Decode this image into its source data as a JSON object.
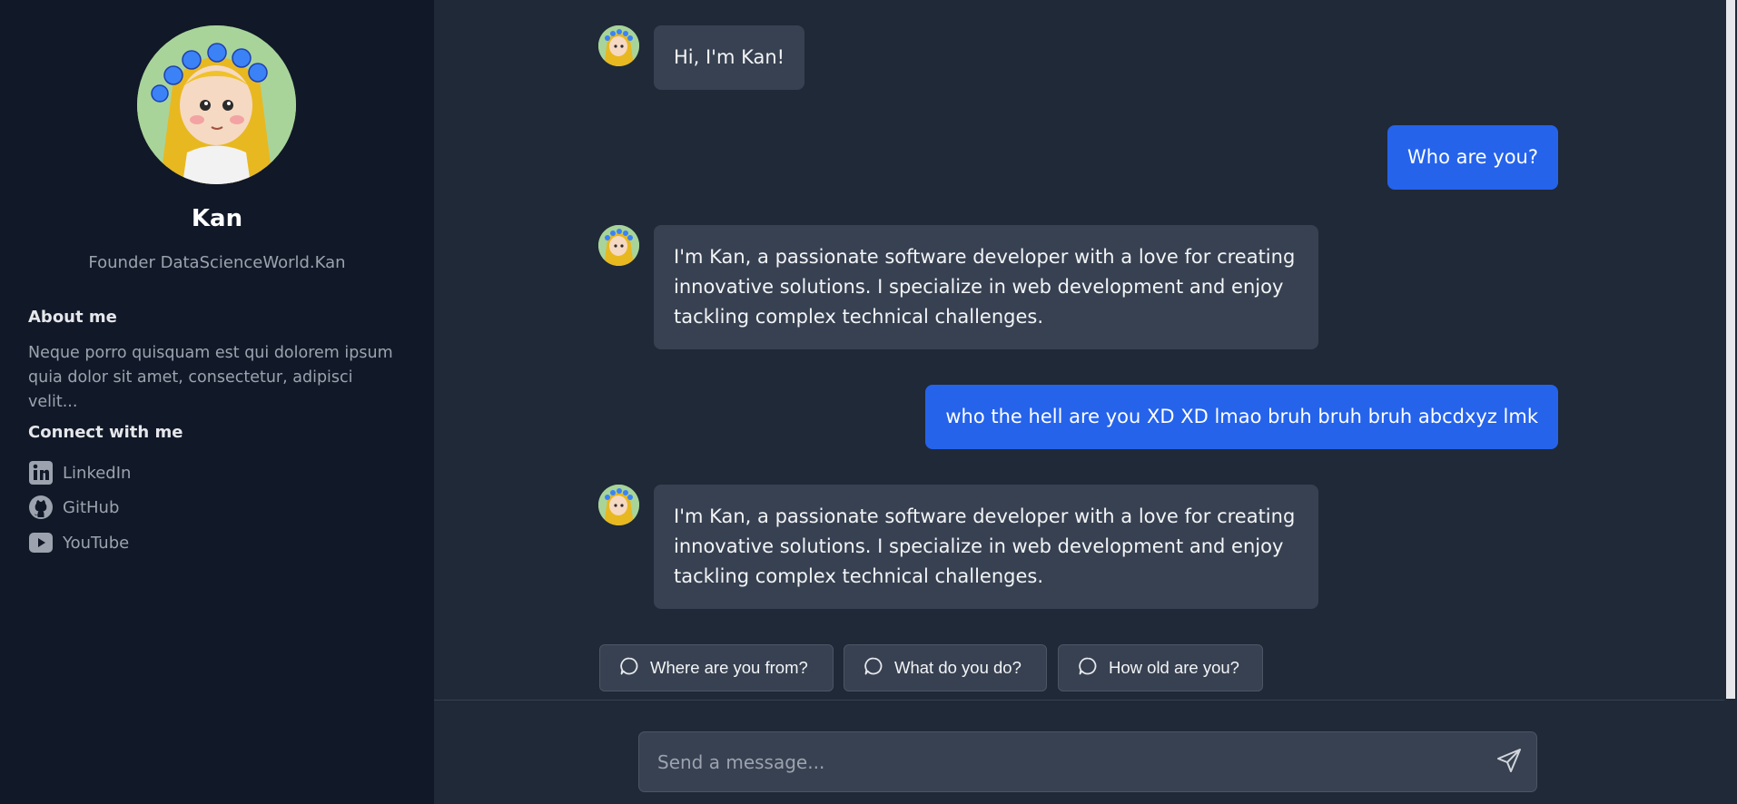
{
  "sidebar": {
    "name": "Kan",
    "title": "Founder DataScienceWorld.Kan",
    "about_heading": "About me",
    "about_text": "Neque porro quisquam est qui dolorem ipsum quia dolor sit amet, consectetur, adipisci velit...",
    "connect_heading": "Connect with me",
    "links": [
      {
        "label": "LinkedIn",
        "icon": "linkedin-icon"
      },
      {
        "label": "GitHub",
        "icon": "github-icon"
      },
      {
        "label": "YouTube",
        "icon": "youtube-icon"
      }
    ]
  },
  "chat": {
    "messages": [
      {
        "role": "bot",
        "text": "Hi, I'm Kan!"
      },
      {
        "role": "user",
        "text": "Who are you?"
      },
      {
        "role": "bot",
        "text": "I'm Kan, a passionate software developer with a love for creating innovative solutions. I specialize in web development and enjoy tackling complex technical challenges."
      },
      {
        "role": "user",
        "text": "who the hell are you XD XD lmao bruh bruh bruh abcdxyz lmk"
      },
      {
        "role": "bot",
        "text": "I'm Kan, a passionate software developer with a love for creating innovative solutions. I specialize in web development and enjoy tackling complex technical challenges."
      }
    ],
    "suggestions": [
      "Where are you from?",
      "What do you do?",
      "How old are you?"
    ]
  },
  "composer": {
    "placeholder": "Send a message..."
  },
  "colors": {
    "sidebar_bg": "#111827",
    "main_bg": "#1f2937",
    "bot_bubble": "#374151",
    "user_bubble": "#2563eb"
  }
}
